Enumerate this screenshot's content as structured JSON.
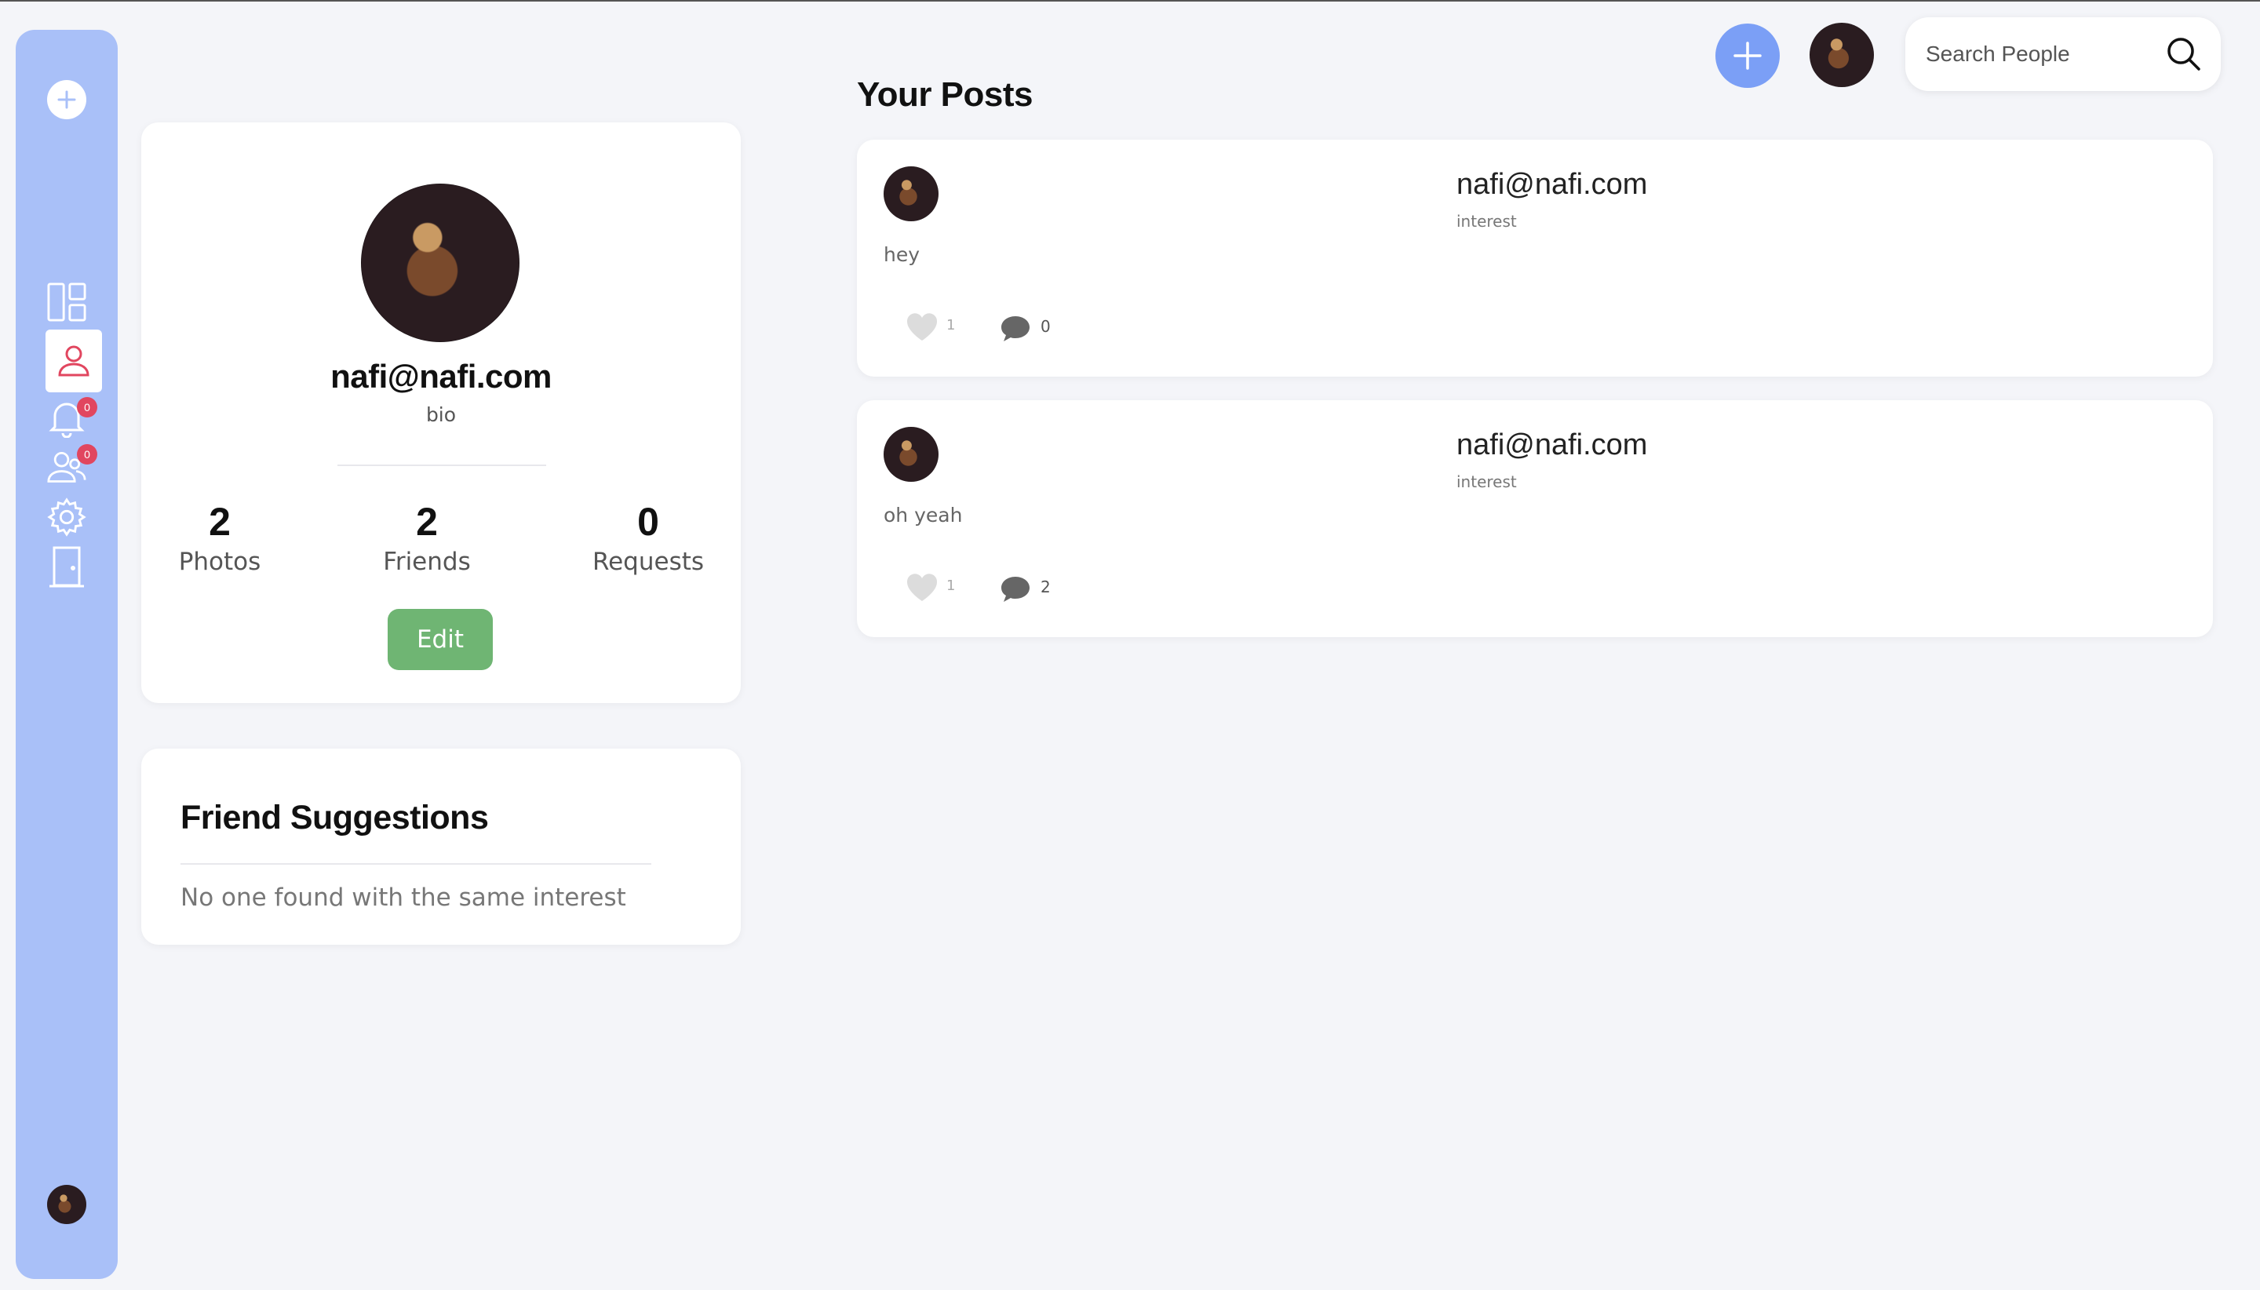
{
  "sidebar": {
    "items": [
      {
        "name": "dashboard",
        "icon": "dashboard-icon"
      },
      {
        "name": "profile",
        "icon": "user-icon",
        "active": true
      },
      {
        "name": "notifications",
        "icon": "bell-icon",
        "badge": "0"
      },
      {
        "name": "friends",
        "icon": "friends-icon",
        "badge": "0"
      },
      {
        "name": "settings",
        "icon": "gear-icon"
      },
      {
        "name": "logout",
        "icon": "door-icon"
      }
    ]
  },
  "header": {
    "search_placeholder": "Search People"
  },
  "profile": {
    "name": "nafi@nafi.com",
    "bio": "bio",
    "stats": [
      {
        "value": "2",
        "label": "Photos"
      },
      {
        "value": "2",
        "label": "Friends"
      },
      {
        "value": "0",
        "label": "Requests"
      }
    ],
    "edit_label": "Edit"
  },
  "friend_suggestions": {
    "title": "Friend Suggestions",
    "empty_message": "No one found with the same interest"
  },
  "posts_section": {
    "title": "Your Posts"
  },
  "posts": [
    {
      "author": "nafi@nafi.com",
      "interest": "interest",
      "text": "hey",
      "likes": "1",
      "comments": "0"
    },
    {
      "author": "nafi@nafi.com",
      "interest": "interest",
      "text": "oh yeah",
      "likes": "1",
      "comments": "2"
    }
  ],
  "colors": {
    "sidebar": "#a9c0f8",
    "accent": "#7b9ff6",
    "active_icon": "#e1465f",
    "edit_button": "#6fb573",
    "background": "#f4f5f9"
  }
}
